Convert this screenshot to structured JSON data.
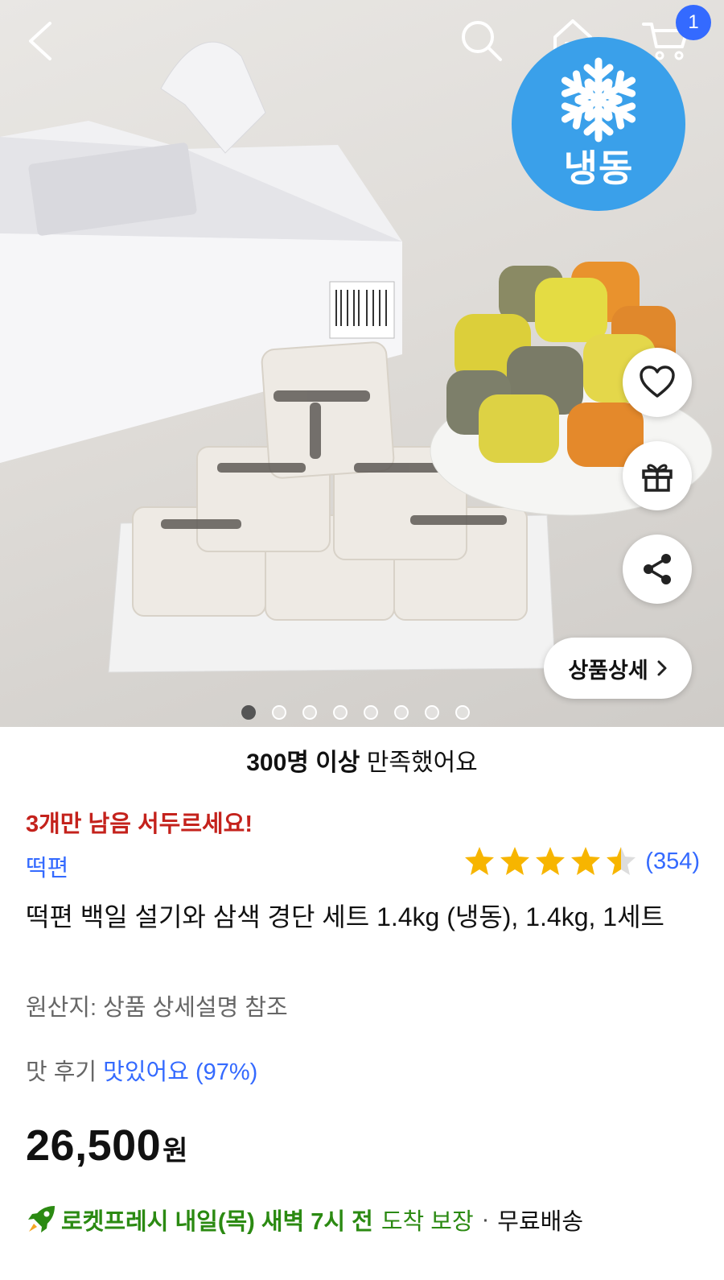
{
  "header": {
    "back_icon": "chevron-left-icon",
    "search_icon": "search-icon",
    "home_icon": "home-icon",
    "cart_icon": "cart-icon",
    "cart_count": "1"
  },
  "hero": {
    "frozen_badge_label": "냉동",
    "frozen_icon": "snowflake-icon",
    "detail_button_label": "상품상세",
    "image_count": 8,
    "active_image_index": 0
  },
  "summary": {
    "satisfied_bold": "300명 이상",
    "satisfied_rest": "만족했어요",
    "stock_alert": "3개만 남음 서두르세요!"
  },
  "product": {
    "brand": "떡편",
    "rating_stars": 4.5,
    "review_count": "(354)",
    "title": "떡편 백일 설기와 삼색 경단 세트 1.4kg (냉동), 1.4kg, 1세트",
    "origin": "원산지: 상품 상세설명 참조",
    "taste_label": "맛 후기",
    "taste_value": "맛있어요 (97%)",
    "price": "26,500",
    "price_unit": "원"
  },
  "delivery": {
    "fresh_text": "로켓프레시 내일(목) 새벽 7시 전",
    "guarantee_text": "도착 보장",
    "separator": "·",
    "free_shipping": "무료배송"
  },
  "colors": {
    "accent_blue": "#346aff",
    "alert_red": "#c4221c",
    "rocket_green": "#2b8a12",
    "star_gold": "#f7b500",
    "frozen_blue": "#3aa0ea"
  }
}
